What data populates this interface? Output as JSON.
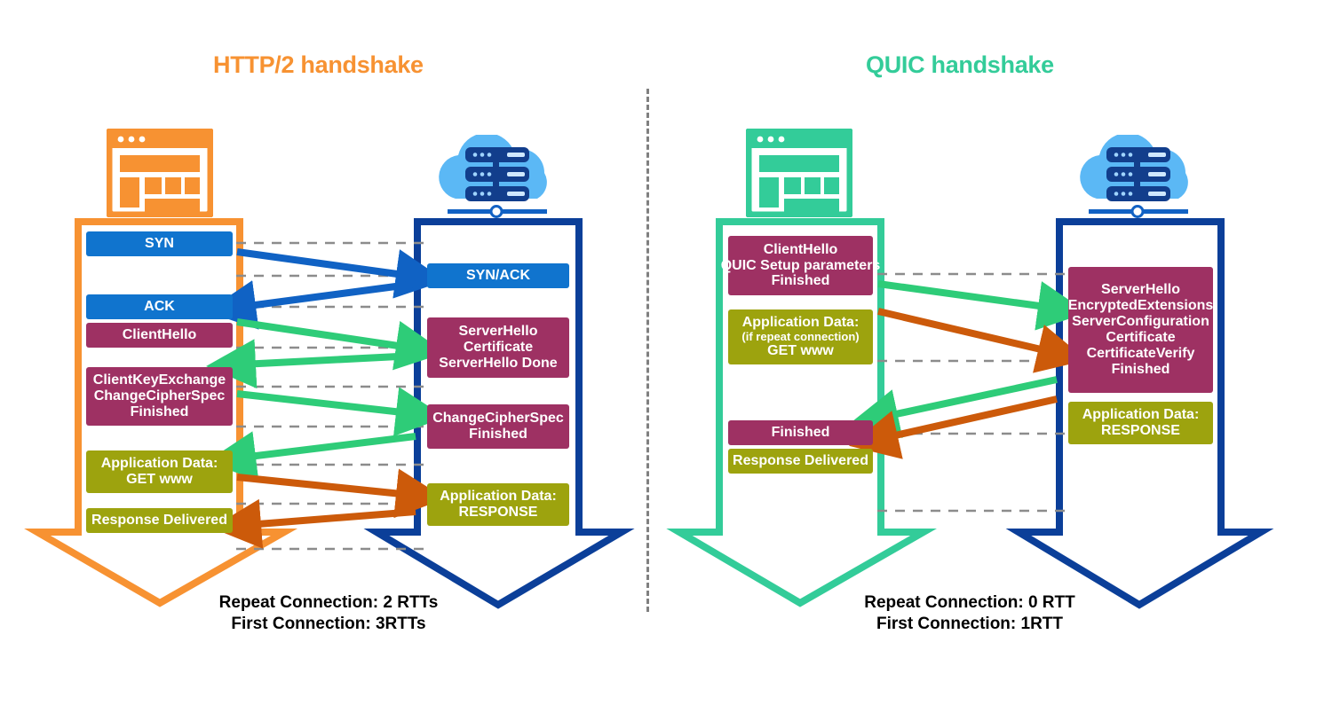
{
  "page": {
    "title_left": "HTTP/2 handshake",
    "title_right": "QUIC handshake",
    "separator": "vertical-dashed-divider"
  },
  "colors": {
    "orange": "#f79232",
    "green": "#33cc99",
    "navy": "#0b3f99",
    "blue_msg": "#1074ce",
    "maroon_msg": "#9e3163",
    "olive_msg": "#9da30e",
    "arrow_blue": "#1062c4",
    "arrow_green": "#2ecc78",
    "arrow_orange": "#cc5a0a",
    "dash_gray": "#8c8c8c",
    "cloud_blue": "#5bb8f5",
    "rack_navy": "#123e8c"
  },
  "http2": {
    "title": "HTTP/2 handshake",
    "client": {
      "icon": "browser-window-icon",
      "messages": [
        {
          "id": "syn",
          "color": "blue",
          "lines": [
            "SYN"
          ]
        },
        {
          "id": "ack",
          "color": "blue",
          "lines": [
            "ACK"
          ]
        },
        {
          "id": "clienthello",
          "color": "maroon",
          "lines": [
            "ClientHello"
          ]
        },
        {
          "id": "clientkeyexchange",
          "color": "maroon",
          "lines": [
            "ClientKeyExchange",
            "ChangeCipherSpec",
            "Finished"
          ]
        },
        {
          "id": "appdata-get",
          "color": "olive",
          "lines": [
            "Application Data:",
            "GET www"
          ]
        },
        {
          "id": "response-delivered",
          "color": "olive",
          "lines": [
            "Response Delivered"
          ]
        }
      ]
    },
    "server": {
      "icon": "cloud-server-icon",
      "messages": [
        {
          "id": "synack",
          "color": "blue",
          "lines": [
            "SYN/ACK"
          ]
        },
        {
          "id": "serverhello",
          "color": "maroon",
          "lines": [
            "ServerHello",
            "Certificate",
            "ServerHello Done"
          ]
        },
        {
          "id": "changecipherspec",
          "color": "maroon",
          "lines": [
            "ChangeCipherSpec",
            "Finished"
          ]
        },
        {
          "id": "appdata-response",
          "color": "olive",
          "lines": [
            "Application Data:",
            "RESPONSE"
          ]
        }
      ]
    },
    "footer": "Repeat Connection: 2 RTTs\nFirst Connection: 3RTTs",
    "footer_line1": "Repeat Connection: 2 RTTs",
    "footer_line2": "First Connection: 3RTTs"
  },
  "quic": {
    "title": "QUIC handshake",
    "client": {
      "icon": "browser-window-icon",
      "messages": [
        {
          "id": "clienthello",
          "color": "maroon",
          "lines": [
            "ClientHello",
            "QUIC Setup parameters",
            "Finished"
          ]
        },
        {
          "id": "appdata-get",
          "color": "olive",
          "lines": [
            "Application Data:",
            "(if repeat connection)",
            "GET www"
          ]
        },
        {
          "id": "finished",
          "color": "maroon",
          "lines": [
            "Finished"
          ]
        },
        {
          "id": "response-delivered",
          "color": "olive",
          "lines": [
            "Response Delivered"
          ]
        }
      ]
    },
    "server": {
      "icon": "cloud-server-icon",
      "messages": [
        {
          "id": "serverhello",
          "color": "maroon",
          "lines": [
            "ServerHello",
            "EncryptedExtensions",
            "ServerConfiguration",
            "Certificate",
            "CertificateVerify",
            "Finished"
          ]
        },
        {
          "id": "appdata-response",
          "color": "olive",
          "lines": [
            "Application Data:",
            "RESPONSE"
          ]
        }
      ]
    },
    "footer_line1": "Repeat Connection: 0 RTT",
    "footer_line2": "First Connection: 1RTT"
  }
}
